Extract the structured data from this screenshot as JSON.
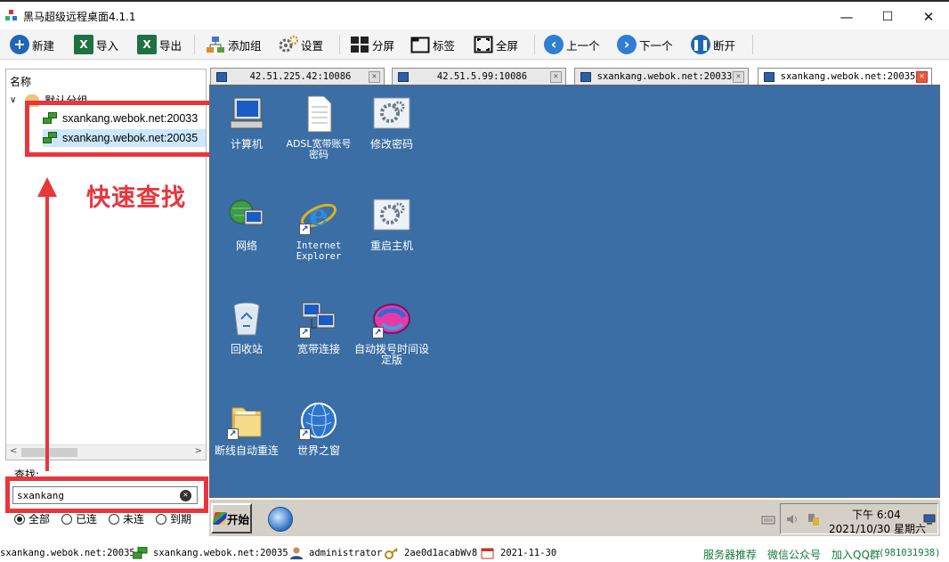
{
  "window": {
    "title": "黑马超级远程桌面4.1.1",
    "minimize_glyph": "—",
    "maximize_glyph": "☐",
    "close_glyph": "✕"
  },
  "toolbar": {
    "new": "新建",
    "import": "导入",
    "export": "导出",
    "add_group": "添加组",
    "settings": "设置",
    "split_screen": "分屏",
    "tag": "标签",
    "fullscreen": "全屏",
    "previous": "上一个",
    "next": "下一个",
    "disconnect": "断开"
  },
  "sidebar": {
    "header": "名称",
    "group_label": "默认分组",
    "items": [
      {
        "label": "sxankang.webok.net:20033"
      },
      {
        "label": "sxankang.webok.net:20035"
      }
    ],
    "search_label": "查找:",
    "search_value": "sxankang",
    "filters": [
      {
        "label": "全部",
        "checked": true
      },
      {
        "label": "已连",
        "checked": false
      },
      {
        "label": "未连",
        "checked": false
      },
      {
        "label": "到期",
        "checked": false
      }
    ]
  },
  "annotation": {
    "text": "快速查找",
    "color": "#e8363d"
  },
  "tabs": [
    {
      "label": "42.51.225.42:10086",
      "active": false
    },
    {
      "label": "42.51.5.99:10086",
      "active": false
    },
    {
      "label": "sxankang.webok.net:20033",
      "active": false
    },
    {
      "label": "sxankang.webok.net:20035",
      "active": true
    }
  ],
  "desktop": {
    "background": "#3a6ea5",
    "icons": [
      {
        "label": "计算机",
        "icon": "computer-icon"
      },
      {
        "label": "ADSL宽带账号密码",
        "icon": "text-document-icon"
      },
      {
        "label": "修改密码",
        "icon": "settings-window-icon"
      },
      {
        "label": "网络",
        "icon": "network-icon"
      },
      {
        "label": "Internet Explorer",
        "icon": "internet-explorer-icon"
      },
      {
        "label": "重启主机",
        "icon": "settings-window-icon"
      },
      {
        "label": "回收站",
        "icon": "recycle-bin-icon"
      },
      {
        "label": "宽带连接",
        "icon": "network-connection-icon"
      },
      {
        "label": "自动拨号时间设定版",
        "icon": "auto-dial-icon"
      },
      {
        "label": "断线自动重连",
        "icon": "folder-icon"
      },
      {
        "label": "世界之窗",
        "icon": "browser-globe-icon"
      }
    ],
    "taskbar": {
      "start": "开始",
      "time": "下午 6:04",
      "date": "2021/10/30 星期六"
    }
  },
  "statusbar": {
    "left_host": "sxankang.webok.net:20035",
    "host": "sxankang.webok.net:20035",
    "user": "administrator",
    "password": "2ae0d1acabWv8",
    "expiry": "2021-11-30",
    "links": [
      "服务器推荐",
      "微信公众号",
      "加入QQ群"
    ],
    "qq_group": "(981031938)"
  }
}
